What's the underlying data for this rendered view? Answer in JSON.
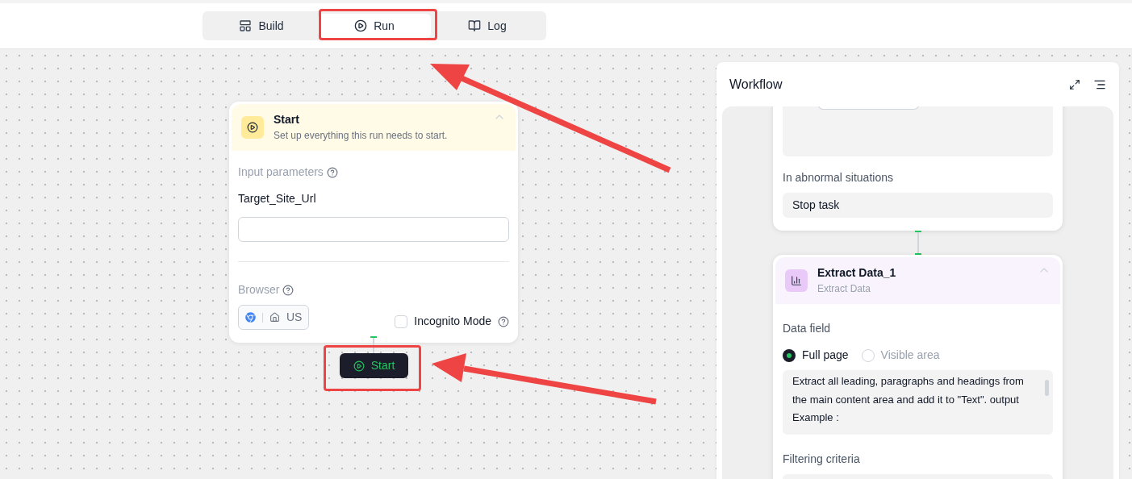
{
  "tabs": [
    {
      "label": "Build",
      "kind": "build",
      "selected": false
    },
    {
      "label": "Run",
      "kind": "run",
      "selected": true
    },
    {
      "label": "Log",
      "kind": "log",
      "selected": false
    }
  ],
  "start_node": {
    "title": "Start",
    "subtitle": "Set up everything this run needs to start.",
    "input_label": "Input parameters",
    "param_name": "Target_Site_Url",
    "browser_label": "Browser",
    "browser_region": "US",
    "incognito": {
      "label": "Incognito Mode",
      "checked": false
    }
  },
  "run_button": {
    "label": "Start"
  },
  "workflow": {
    "title": "Workflow",
    "steps": [
      {
        "kind": "visit",
        "abnormal_label": "In abnormal situations",
        "abnormal_value": "Stop task"
      },
      {
        "kind": "extract",
        "title": "Extract Data_1",
        "subtitle": "Extract Data",
        "data_field_label": "Data field",
        "options": [
          {
            "label": "Full page",
            "selected": true
          },
          {
            "label": "Visible area",
            "selected": false
          }
        ],
        "prompt": "Extract all leading, paragraphs and headings from the main content area and add it to \"Text\". output Example :",
        "filter_label": "Filtering criteria"
      }
    ]
  }
}
